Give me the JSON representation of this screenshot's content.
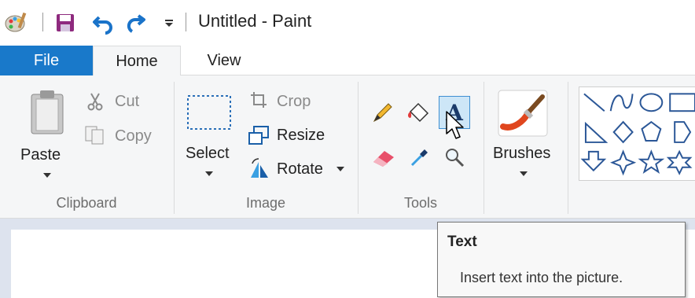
{
  "window": {
    "title": "Untitled - Paint"
  },
  "quick_access": {
    "app_icon": "paint-palette-icon",
    "save_icon": "save-icon",
    "undo_icon": "undo-icon",
    "redo_icon": "redo-icon",
    "customize_icon": "customize-quick-access-icon"
  },
  "tabs": [
    {
      "label": "File",
      "active": false
    },
    {
      "label": "Home",
      "active": true
    },
    {
      "label": "View",
      "active": false
    }
  ],
  "clipboard": {
    "paste_label": "Paste",
    "cut_label": "Cut",
    "copy_label": "Copy",
    "group_label": "Clipboard"
  },
  "image": {
    "select_label": "Select",
    "crop_label": "Crop",
    "resize_label": "Resize",
    "rotate_label": "Rotate",
    "group_label": "Image"
  },
  "tools": {
    "items": [
      "pencil-icon",
      "fill-with-color-icon",
      "text-icon",
      "eraser-icon",
      "color-picker-icon",
      "magnifier-icon"
    ],
    "selected": "text-icon",
    "group_label": "Tools"
  },
  "brushes": {
    "label": "Brushes"
  },
  "shapes": {
    "items": [
      "line-icon",
      "curve-icon",
      "oval-icon",
      "rectangle-icon",
      "right-triangle-icon",
      "diamond-icon",
      "pentagon-icon",
      "hexagon-icon",
      "down-arrow-icon",
      "four-point-star-icon",
      "five-point-star-icon",
      "six-point-star-icon"
    ]
  },
  "tooltip": {
    "title": "Text",
    "description": "Insert text into the picture."
  },
  "colors": {
    "file_tab": "#1979ca",
    "ribbon_bg": "#f5f6f7",
    "shape_stroke": "#2b5797",
    "workspace_bg": "#dde3ee"
  }
}
